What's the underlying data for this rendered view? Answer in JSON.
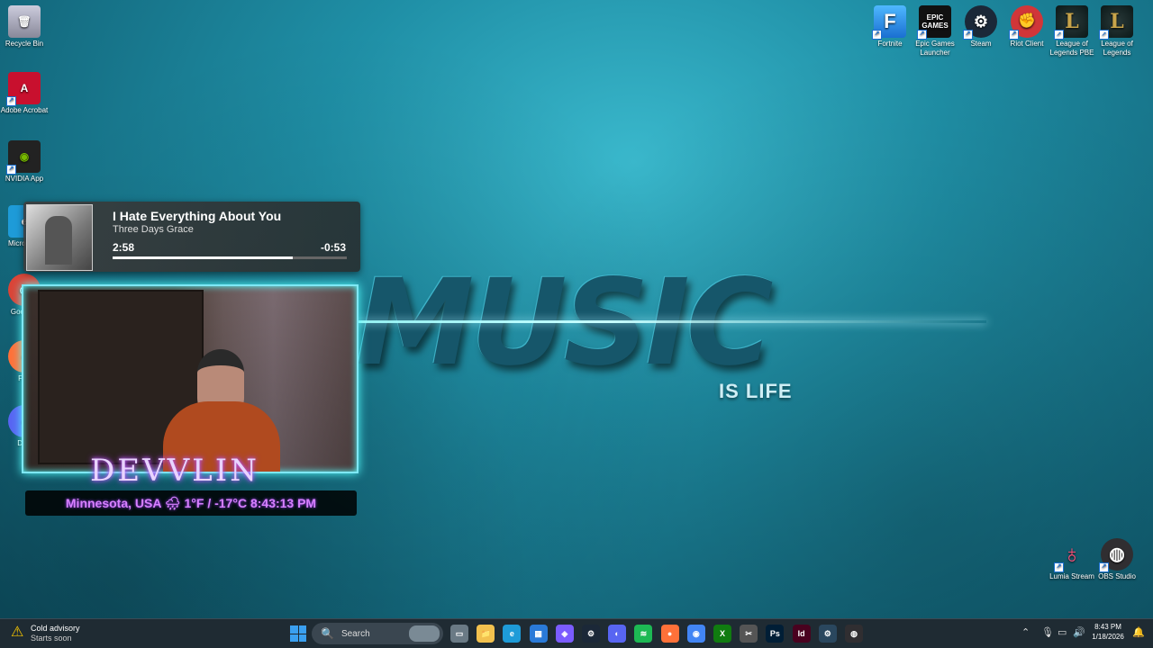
{
  "desktop_icons_left": [
    {
      "label": "Recycle Bin",
      "icon": "recycle-bin-icon"
    },
    {
      "label": "Adobe Acrobat",
      "icon": "acrobat-icon"
    },
    {
      "label": "NVIDIA App",
      "icon": "nvidia-icon"
    },
    {
      "label": "Micro Edg",
      "icon": "edge-icon"
    },
    {
      "label": "Goo Chr",
      "icon": "chrome-icon"
    },
    {
      "label": "Fire",
      "icon": "firefox-icon"
    },
    {
      "label": "Disc",
      "icon": "discord-icon"
    }
  ],
  "desktop_icons_right": [
    {
      "label": "Fortnite",
      "icon": "fortnite-icon",
      "glyph": "F"
    },
    {
      "label": "Epic Games Launcher",
      "icon": "epic-games-icon",
      "glyph": "EPIC GAMES"
    },
    {
      "label": "Steam",
      "icon": "steam-icon",
      "glyph": "⚙"
    },
    {
      "label": "Riot Client",
      "icon": "riot-icon",
      "glyph": "✊"
    },
    {
      "label": "League of Legends PBE",
      "icon": "league-pbe-icon",
      "glyph": "L"
    },
    {
      "label": "League of Legends",
      "icon": "league-icon",
      "glyph": "L"
    }
  ],
  "desktop_icons_bottom_right": [
    {
      "label": "Lumia Stream",
      "icon": "lumia-stream-icon"
    },
    {
      "label": "OBS Studio",
      "icon": "obs-icon"
    }
  ],
  "wallpaper": {
    "title": "MUSIC",
    "subtitle": "IS LIFE"
  },
  "now_playing": {
    "song": "I Hate Everything About You",
    "artist": "Three Days Grace",
    "elapsed": "2:58",
    "remaining": "-0:53",
    "progress_fraction": 0.77
  },
  "webcam_overlay": {
    "name": "DEVVLIN",
    "location": "Minnesota, USA",
    "weather_icon": "🌧",
    "temperature": "1°F / -17°C",
    "time": "8:43:13 PM"
  },
  "taskbar": {
    "weather_title": "Cold advisory",
    "weather_sub": "Starts soon",
    "search_placeholder": "Search",
    "apps": [
      {
        "name": "file-explorer-icon",
        "glyph": "▭",
        "color": "#6a7a85"
      },
      {
        "name": "folder-icon",
        "glyph": "📁",
        "color": "#f2c14e"
      },
      {
        "name": "edge-icon",
        "glyph": "e",
        "color": "#1e9bd8"
      },
      {
        "name": "store-icon",
        "glyph": "▦",
        "color": "#2a7ad8"
      },
      {
        "name": "copilot-icon",
        "glyph": "◈",
        "color": "#7b5cff"
      },
      {
        "name": "steam-icon",
        "glyph": "⚙",
        "color": "#1b2838"
      },
      {
        "name": "discord-icon",
        "glyph": "◐",
        "color": "#5865f2"
      },
      {
        "name": "spotify-icon",
        "glyph": "≋",
        "color": "#1db954"
      },
      {
        "name": "firefox-icon",
        "glyph": "●",
        "color": "#ff7139"
      },
      {
        "name": "chrome-icon",
        "glyph": "◉",
        "color": "#4285f4"
      },
      {
        "name": "xbox-icon",
        "glyph": "X",
        "color": "#107c10"
      },
      {
        "name": "snipping-tool-icon",
        "glyph": "✂",
        "color": "#555"
      },
      {
        "name": "photoshop-icon",
        "glyph": "Ps",
        "color": "#001e36"
      },
      {
        "name": "indesign-icon",
        "glyph": "Id",
        "color": "#49021f"
      },
      {
        "name": "steam-alt-icon",
        "glyph": "⚙",
        "color": "#2a475e"
      },
      {
        "name": "obs-icon",
        "glyph": "◍",
        "color": "#302e31"
      }
    ],
    "time": "8:43 PM",
    "date": "1/18/2026"
  }
}
